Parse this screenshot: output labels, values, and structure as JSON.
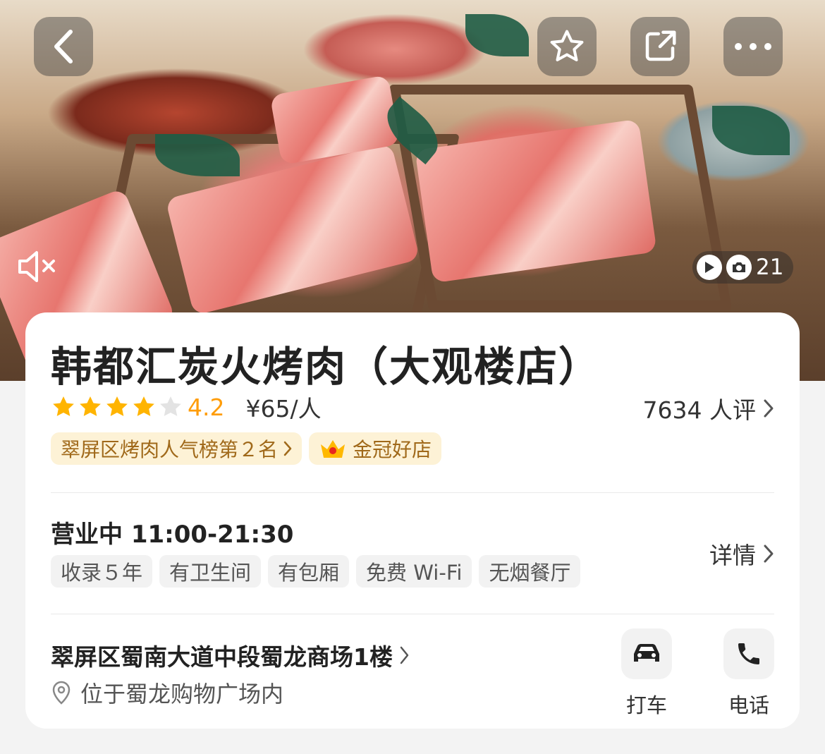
{
  "shop": {
    "name": "韩都汇炭火烤肉（大观楼店）",
    "rating": 4.2,
    "rating_text": "4.2",
    "stars_filled": 4,
    "stars_total": 5,
    "price": "¥65/人",
    "reviews": "7634 人评"
  },
  "badges": {
    "ranking": "翠屏区烤肉人气榜第２名",
    "crown": "金冠好店"
  },
  "hours": "营业中 11:00-21:30",
  "tags": [
    "收录５年",
    "有卫生间",
    "有包厢",
    "免费 Wi-Fi",
    "无烟餐厅"
  ],
  "details_label": "详情",
  "address": "翠屏区蜀南大道中段蜀龙商场1楼",
  "location_note": "位于蜀龙购物广场内",
  "actions": {
    "taxi": "打车",
    "phone": "电话"
  },
  "media": {
    "count": "21"
  },
  "colors": {
    "star": "#ffb400",
    "score": "#ff9d0a",
    "badge_bg": "#fdf2d6",
    "badge_text": "#a0691a"
  }
}
